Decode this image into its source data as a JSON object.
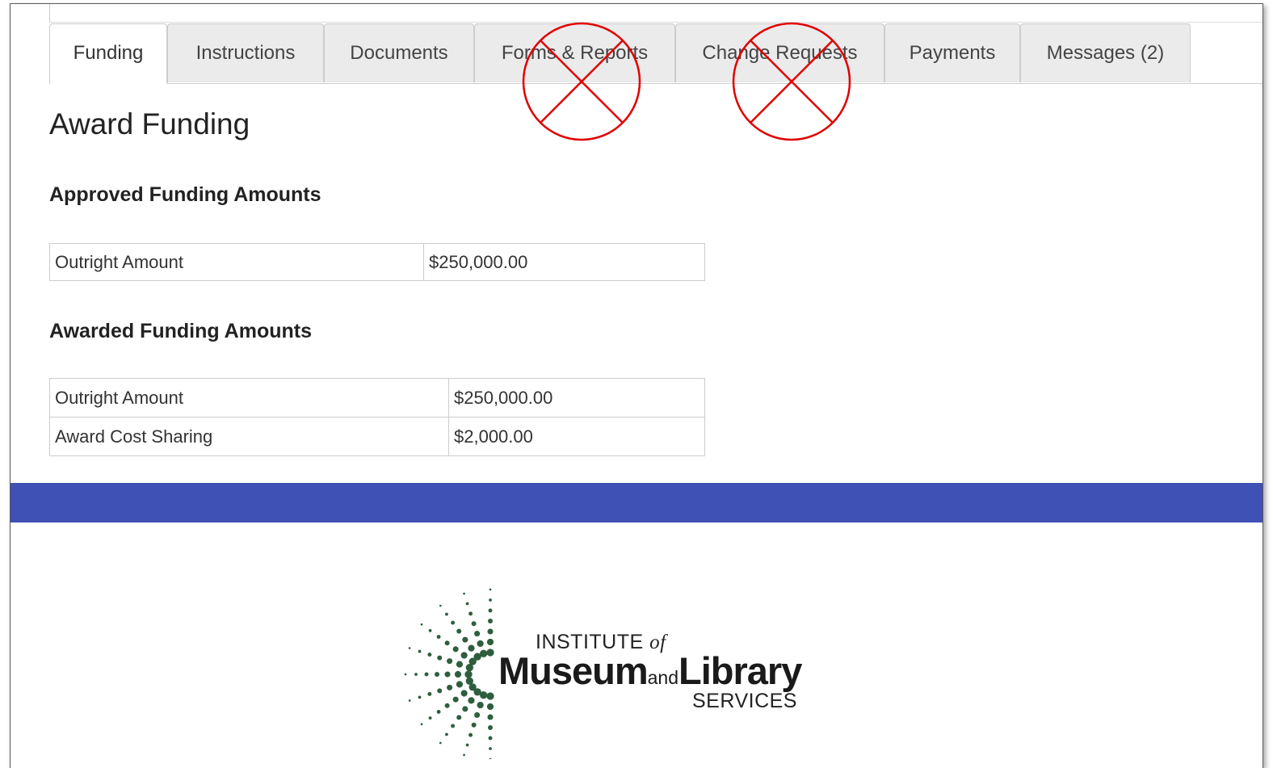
{
  "tabs": [
    {
      "label": "Funding",
      "active": true
    },
    {
      "label": "Instructions",
      "active": false
    },
    {
      "label": "Documents",
      "active": false
    },
    {
      "label": "Forms & Reports",
      "active": false,
      "crossed_out": true
    },
    {
      "label": "Change Requests",
      "active": false,
      "crossed_out": true
    },
    {
      "label": "Payments",
      "active": false
    },
    {
      "label": "Messages (2)",
      "active": false
    }
  ],
  "page_title": "Award Funding",
  "approved": {
    "title": "Approved Funding Amounts",
    "rows": [
      {
        "label": "Outright Amount",
        "value": "$250,000.00"
      }
    ]
  },
  "awarded": {
    "title": "Awarded Funding Amounts",
    "rows": [
      {
        "label": "Outright Amount",
        "value": "$250,000.00"
      },
      {
        "label": "Award Cost Sharing",
        "value": "$2,000.00"
      }
    ]
  },
  "footer": {
    "band_color": "#3f51b5",
    "logo": {
      "line1": "INSTITUTE",
      "line1_of": "of",
      "main_left": "Museum",
      "main_and": "and",
      "main_right": "Library",
      "line3": "SERVICES",
      "mark_color": "#2e5e3e"
    }
  },
  "annotation_color": "#e00000"
}
